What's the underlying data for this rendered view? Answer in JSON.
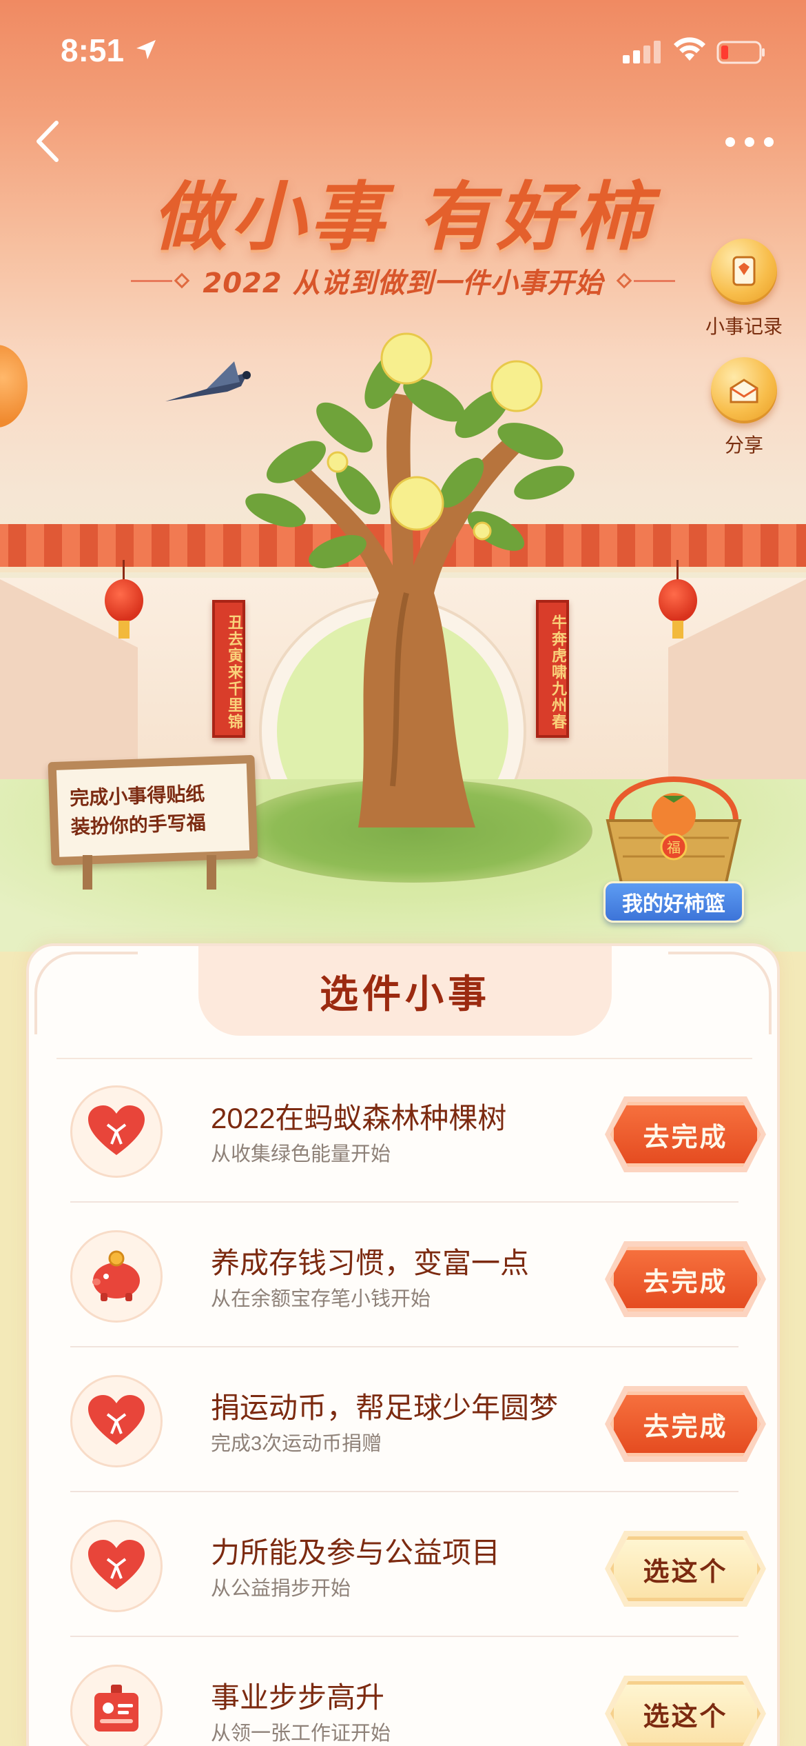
{
  "status_bar": {
    "time": "8:51"
  },
  "hero": {
    "title": "做小事 有好柿",
    "subtitle": "2022 从说到做到一件小事开始",
    "side_buttons": [
      {
        "label": "小事记录",
        "icon": "record-icon"
      },
      {
        "label": "分享",
        "icon": "share-icon"
      }
    ],
    "couplet_left": "丑去寅来千里锦",
    "couplet_right": "牛奔虎啸九州春",
    "sign_lines": [
      "完成小事得贴纸",
      "装扮你的手写福"
    ],
    "basket_fu": "福",
    "basket_button": "我的好柿篮"
  },
  "card": {
    "title": "选件小事",
    "tasks": [
      {
        "title": "2022在蚂蚁森林种棵树",
        "subtitle": "从收集绿色能量开始",
        "button": "去完成",
        "button_style": "go",
        "icon": "heart-gift-icon"
      },
      {
        "title": "养成存钱习惯，变富一点",
        "subtitle": "从在余额宝存笔小钱开始",
        "button": "去完成",
        "button_style": "go",
        "icon": "piggy-bank-icon"
      },
      {
        "title": "捐运动币，帮足球少年圆梦",
        "subtitle": "完成3次运动币捐赠",
        "button": "去完成",
        "button_style": "go",
        "icon": "heart-gift-icon"
      },
      {
        "title": "力所能及参与公益项目",
        "subtitle": "从公益捐步开始",
        "button": "选这个",
        "button_style": "pick",
        "icon": "heart-gift-icon"
      },
      {
        "title": "事业步步高升",
        "subtitle": "从领一张工作证开始",
        "button": "选这个",
        "button_style": "pick",
        "icon": "work-badge-icon"
      }
    ]
  },
  "colors": {
    "accent": "#e4602c",
    "go_button": "#e44a1f",
    "pick_button": "#fbe2a8",
    "title_text": "#7c2a10"
  }
}
